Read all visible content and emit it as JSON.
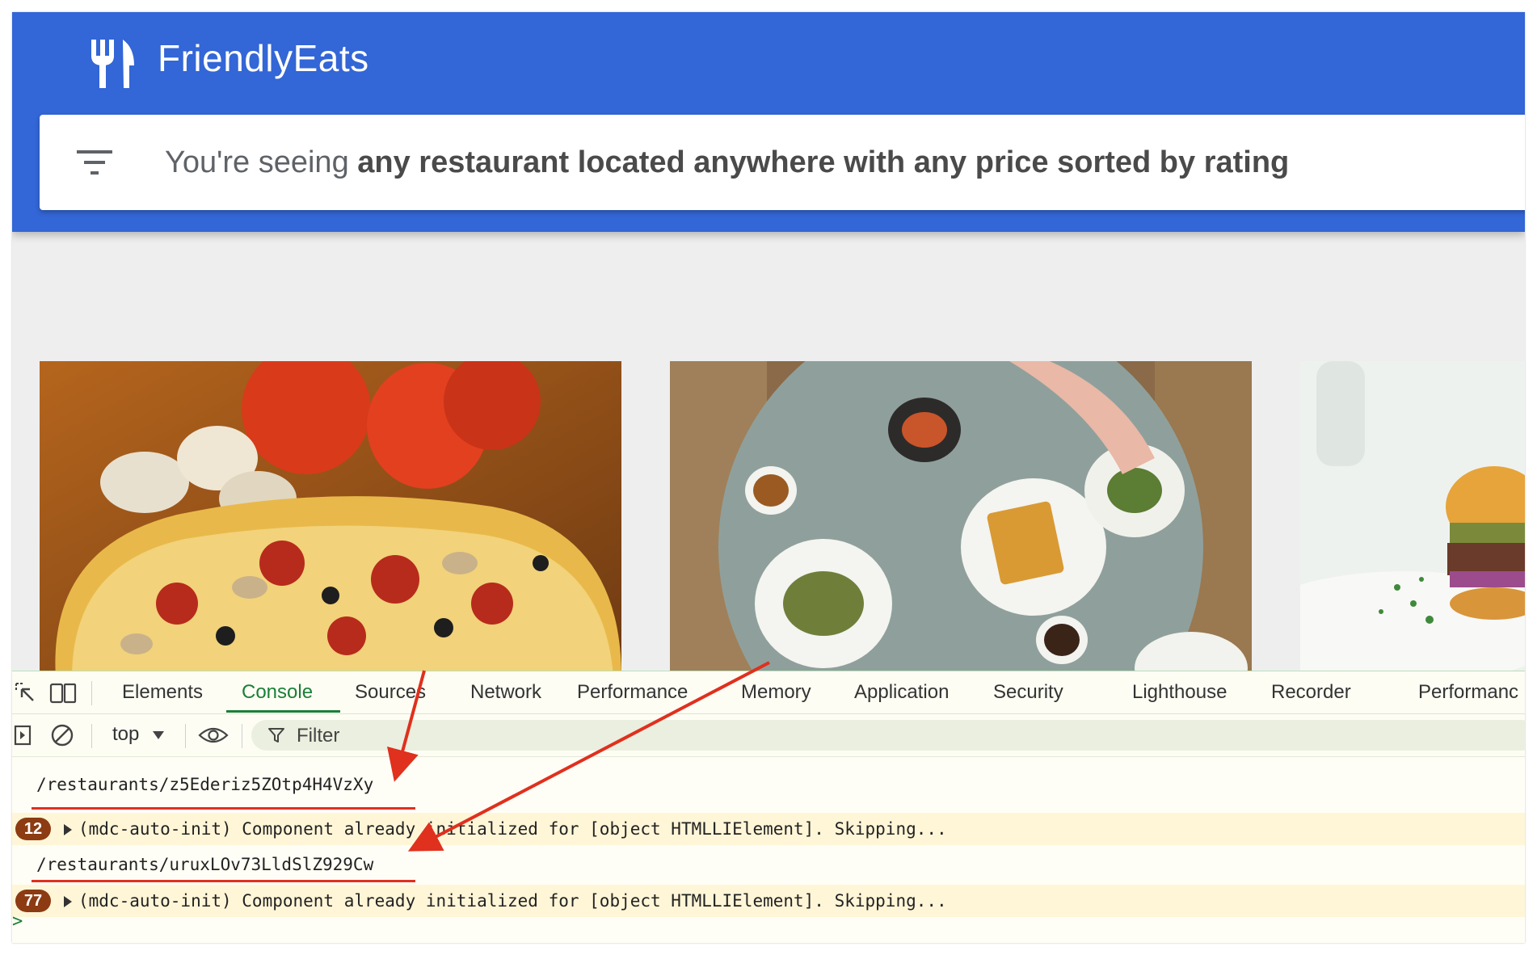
{
  "app": {
    "brand": "FriendlyEats",
    "logo_icon": "restaurant-icon",
    "filter_icon": "filter-list-icon",
    "filter_prefix": "You're seeing ",
    "filter_summary": "any restaurant located anywhere with any price sorted by rating",
    "header_color": "#3366d6"
  },
  "cards": [
    {
      "image": "pizza with mushrooms, pepperoni, olives and tomatoes"
    },
    {
      "image": "overhead view of a brunch table with waffles and coffee"
    },
    {
      "image": "burger on a white surface"
    }
  ],
  "devtools": {
    "tabs": [
      "Elements",
      "Console",
      "Sources",
      "Network",
      "Performance",
      "Memory",
      "Application",
      "Security",
      "Lighthouse",
      "Recorder",
      "Performanc"
    ],
    "active_tab": "Console",
    "context": "top",
    "filter_placeholder": "Filter",
    "icons": {
      "inspect": "inspect-element-icon",
      "device": "device-toolbar-icon",
      "sidebar": "show-sidebar-icon",
      "clear": "clear-console-icon",
      "eye": "live-expression-icon",
      "filter": "filter-icon",
      "prompt": "console-prompt-icon"
    },
    "messages": [
      {
        "type": "log",
        "text": "/restaurants/z5Ederiz5ZOtp4H4VzXy"
      },
      {
        "type": "warning",
        "count": "12",
        "text": "(mdc-auto-init) Component already initialized for [object HTMLLIElement]. Skipping..."
      },
      {
        "type": "log",
        "text": "/restaurants/uruxLOv73LldSlZ929Cw"
      },
      {
        "type": "warning",
        "count": "77",
        "text": "(mdc-auto-init) Component already initialized for [object HTMLLIElement]. Skipping..."
      }
    ],
    "prompt_symbol": ">",
    "accent_color": "#1a7f37",
    "annotation_color": "#e0301e"
  }
}
